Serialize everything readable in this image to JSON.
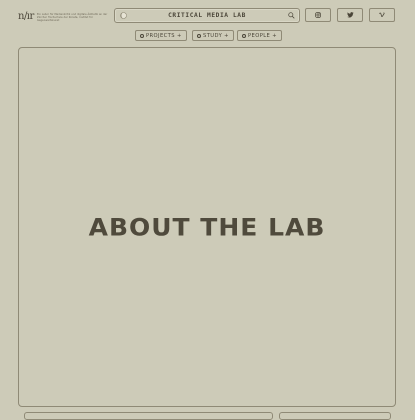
{
  "header": {
    "logo_text": "n/ır",
    "tagline": "Ein Labor für Medienkritik und digitale Ästhetik an der Zürcher Hochschule der Künste, Institut für Gegenwartskunst",
    "search_title": "CRITICAL MEDIA LAB"
  },
  "social": {
    "items": [
      {
        "icon": "instagram-icon"
      },
      {
        "icon": "twitter-icon"
      },
      {
        "icon": "vimeo-icon"
      }
    ]
  },
  "nav": {
    "items": [
      {
        "label": "PROJECTS +"
      },
      {
        "label": "STUDY +"
      },
      {
        "label": "PEOPLE +"
      }
    ]
  },
  "main": {
    "heading": "ABOUT THE LAB"
  },
  "colors": {
    "background": "#cdcbb8",
    "text": "#4a4538",
    "border": "#8f8a76"
  }
}
